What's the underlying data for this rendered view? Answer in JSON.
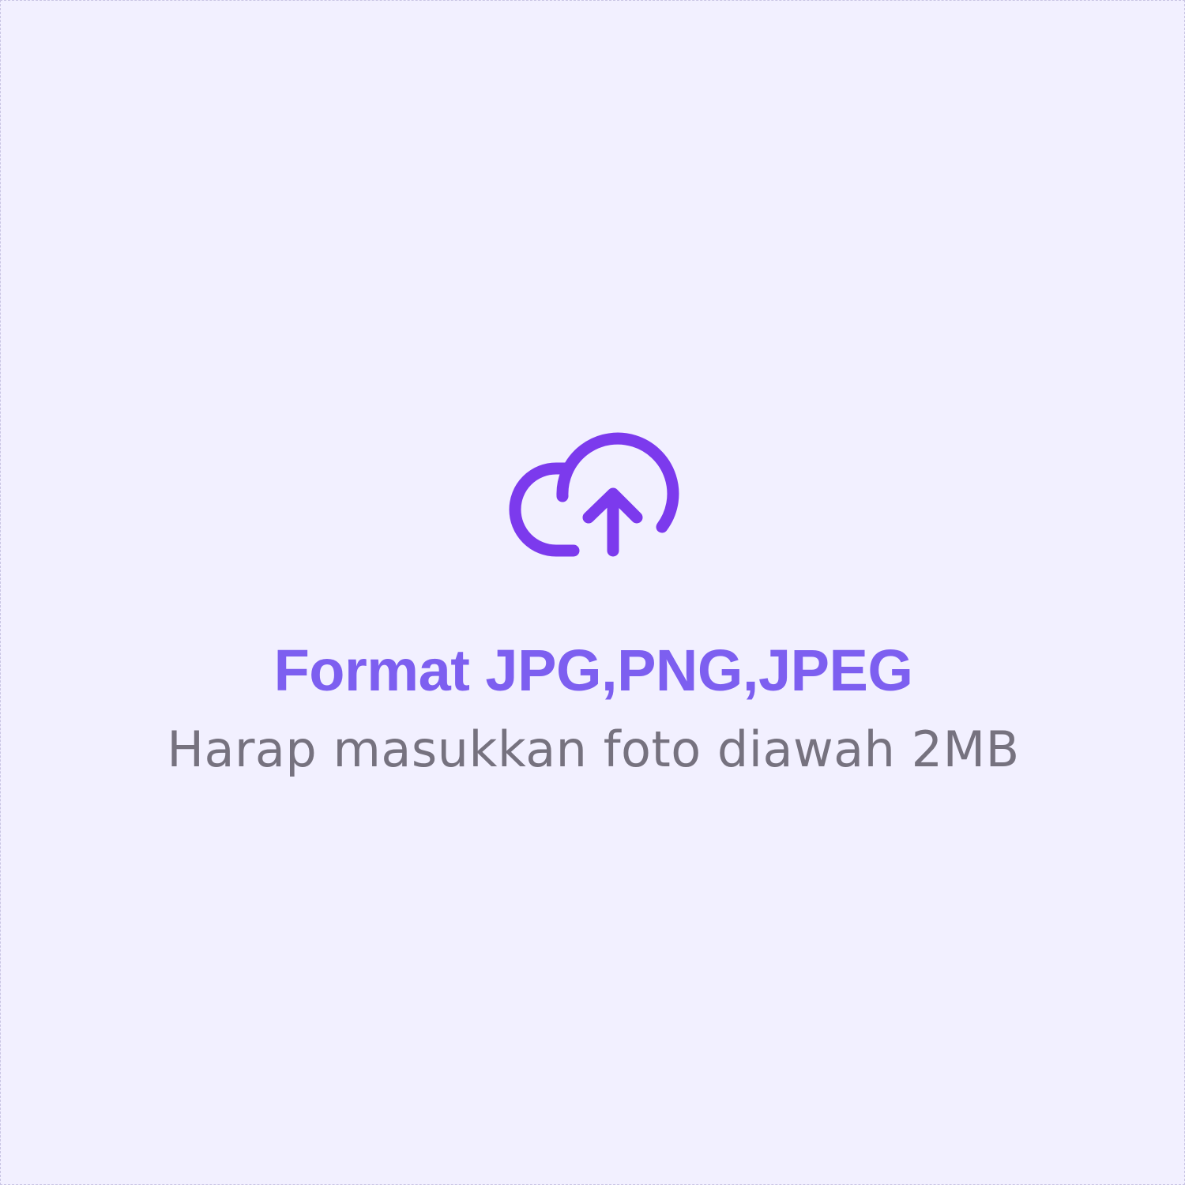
{
  "upload": {
    "icon": "cloud-upload-icon",
    "format_text": "Format JPG,PNG,JPEG",
    "size_hint": "Harap masukkan foto diawah 2MB"
  },
  "colors": {
    "background": "#f2f0ff",
    "accent": "#7c3aed",
    "title": "#7d5ff0",
    "hint": "#76727f",
    "border": "#c9c4e3"
  }
}
